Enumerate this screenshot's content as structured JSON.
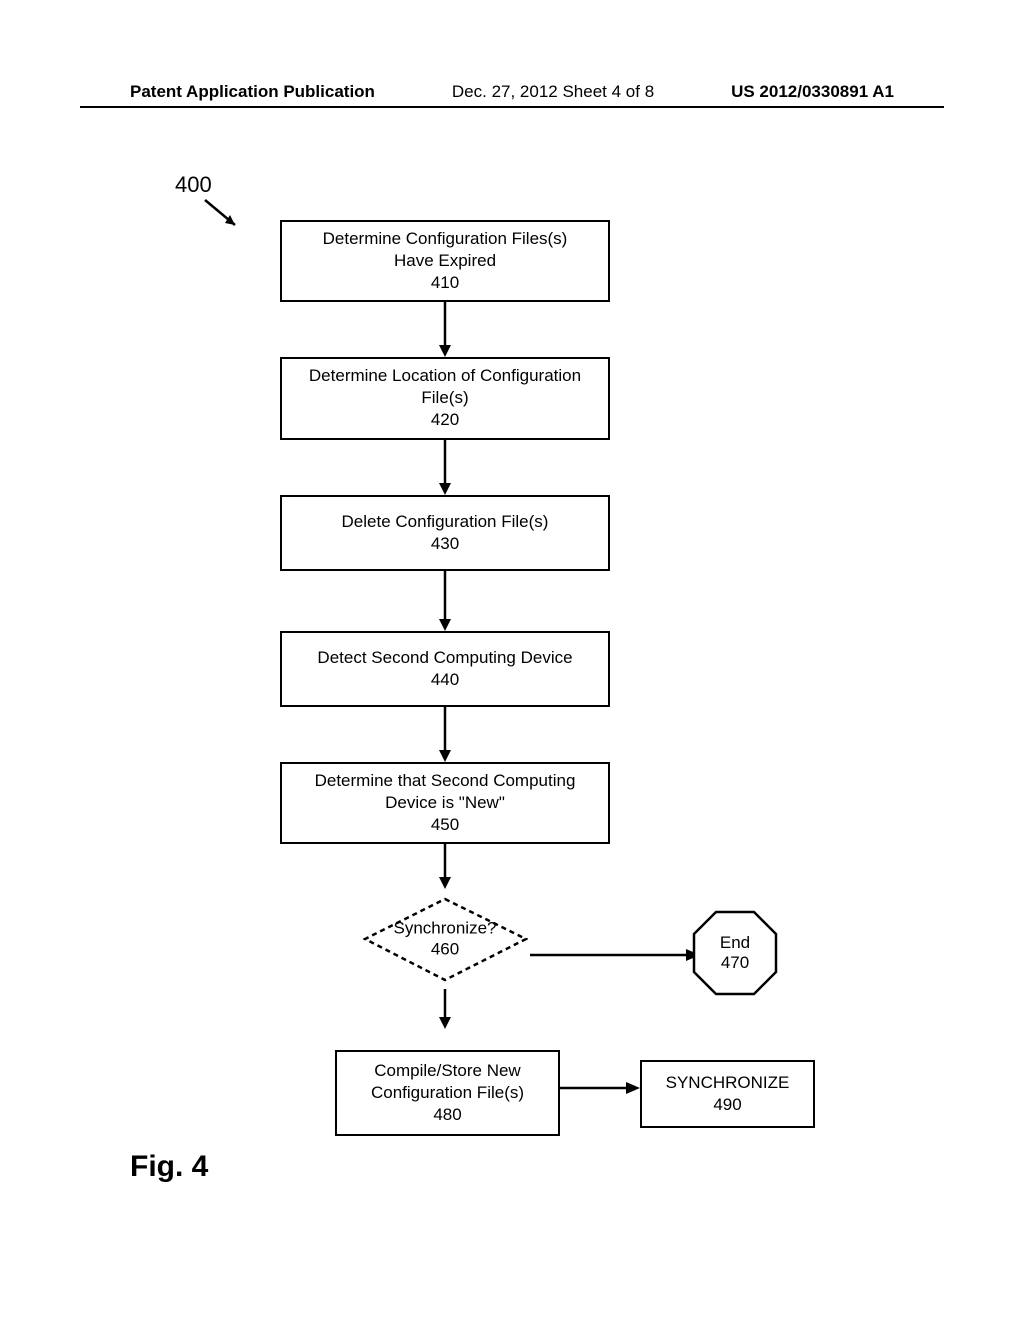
{
  "header": {
    "left": "Patent Application Publication",
    "center": "Dec. 27, 2012  Sheet 4 of 8",
    "right": "US 2012/0330891 A1"
  },
  "refNum": "400",
  "boxes": {
    "b410": {
      "line1": "Determine Configuration Files(s)",
      "line2": "Have Expired",
      "num": "410"
    },
    "b420": {
      "line1": "Determine Location of Configuration",
      "line2": "File(s)",
      "num": "420"
    },
    "b430": {
      "line1": "Delete Configuration File(s)",
      "num": "430"
    },
    "b440": {
      "line1": "Detect Second Computing Device",
      "num": "440"
    },
    "b450": {
      "line1": "Determine that Second Computing",
      "line2": "Device is \"New\"",
      "num": "450"
    },
    "b460": {
      "line1": "Synchronize?",
      "num": "460"
    },
    "b470": {
      "line1": "End",
      "num": "470"
    },
    "b480": {
      "line1": "Compile/Store New",
      "line2": "Configuration File(s)",
      "num": "480"
    },
    "b490": {
      "line1": "SYNCHRONIZE",
      "num": "490"
    }
  },
  "figLabel": "Fig.  4"
}
